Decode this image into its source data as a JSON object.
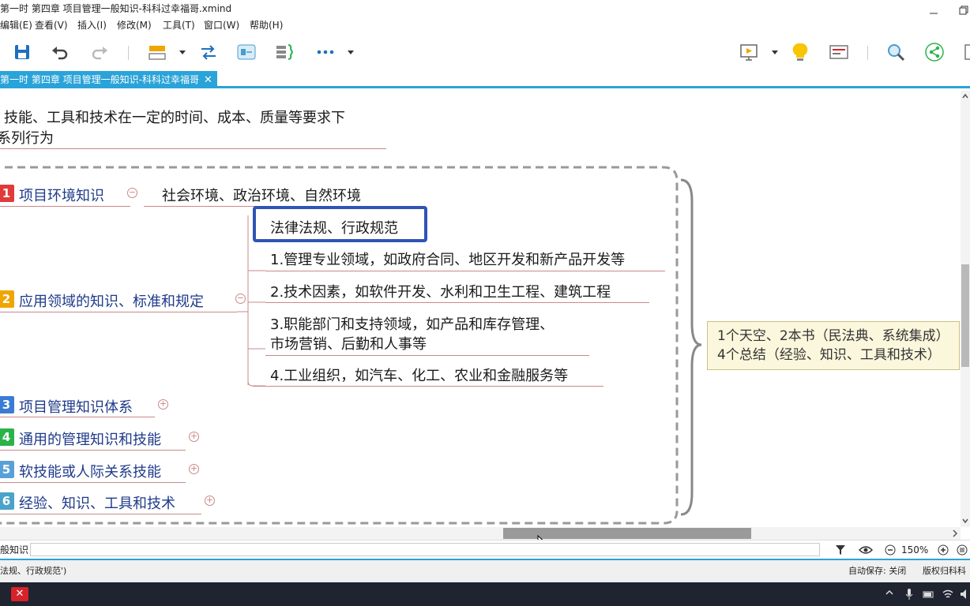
{
  "window": {
    "title": "第一时 第四章 项目管理一般知识-科科过幸福哥.xmind"
  },
  "menu": [
    "编辑(E)",
    "查看(V)",
    "插入(I)",
    "修改(M)",
    "工具(T)",
    "窗口(W)",
    "帮助(H)"
  ],
  "toolbar": {
    "icons": [
      "save-icon",
      "undo-icon",
      "redo-icon",
      "topic-icon",
      "relationship-icon",
      "boundary-icon",
      "summary-icon",
      "more-icon",
      "presentation-icon",
      "idea-icon",
      "outline-icon",
      "search-icon",
      "share-icon"
    ]
  },
  "tab": {
    "label": "第一时 第四章 项目管理一般知识-科科过幸福哥",
    "close": "✕"
  },
  "canvas": {
    "intro_line1": "技能、工具和技术在一定的时间、成本、质量等要求下",
    "intro_line2": "系列行为",
    "branches": [
      {
        "num": "1",
        "label": "项目环境知识",
        "color": "#e03b3b",
        "toggle": "−"
      },
      {
        "num": "2",
        "label": "应用领域的知识、标准和规定",
        "color": "#f0a500",
        "toggle": "−"
      },
      {
        "num": "3",
        "label": "项目管理知识体系",
        "color": "#3a7bd5",
        "toggle": "+"
      },
      {
        "num": "4",
        "label": "通用的管理知识和技能",
        "color": "#2bb34a",
        "toggle": "+"
      },
      {
        "num": "5",
        "label": "软技能或人际关系技能",
        "color": "#5aa0d8",
        "toggle": "+"
      },
      {
        "num": "6",
        "label": "经验、知识、工具和技术",
        "color": "#4aa3c8",
        "toggle": "+"
      }
    ],
    "branch1_child": "社会环境、政治环境、自然环境",
    "branch2_children": {
      "selected": "法律法规、行政规范",
      "c1": "1.管理专业领域，如政府合同、地区开发和新产品开发等",
      "c2": "2.技术因素，如软件开发、水利和卫生工程、建筑工程",
      "c3_line1": "3.职能部门和支持领域，如产品和库存管理、",
      "c3_line2": "市场营销、后勤和人事等",
      "c4": "4.工业组织，如汽车、化工、农业和金融服务等"
    },
    "summary_line1": "1个天空、2本书（民法典、系统集成）",
    "summary_line2": "4个总结（经验、知识、工具和技术）"
  },
  "bottombar": {
    "breadcrumb": "般知识",
    "zoom": "150%"
  },
  "statusbar": {
    "left": "法规、行政规范')",
    "autosave": "自动保存: 关闭",
    "copyright": "版权归科科过"
  },
  "taskbar": {
    "app_icon": "xmind-icon"
  }
}
